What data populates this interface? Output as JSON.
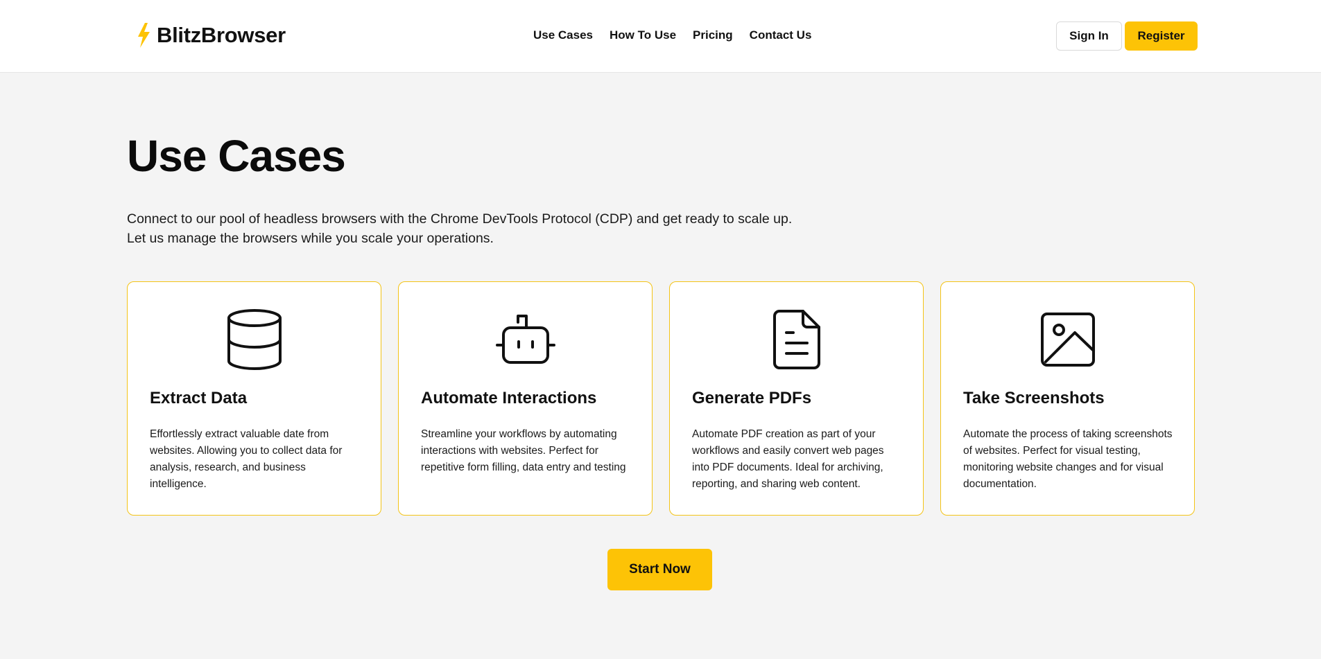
{
  "brand": {
    "name": "BlitzBrowser",
    "icon": "lightning-bolt-icon",
    "accent_color": "#fdc306"
  },
  "nav": {
    "items": [
      {
        "label": "Use Cases"
      },
      {
        "label": "How To Use"
      },
      {
        "label": "Pricing"
      },
      {
        "label": "Contact Us"
      }
    ]
  },
  "auth": {
    "signin_label": "Sign In",
    "register_label": "Register"
  },
  "main": {
    "title": "Use Cases",
    "intro_line1": "Connect to our pool of headless browsers with the Chrome DevTools Protocol (CDP) and get ready to scale up.",
    "intro_line2": "Let us manage the browsers while you scale your operations.",
    "cards": [
      {
        "icon": "database-icon",
        "title": "Extract Data",
        "description": "Effortlessly extract valuable date from websites. Allowing you to collect data for analysis, research, and business intelligence."
      },
      {
        "icon": "robot-icon",
        "title": "Automate Interactions",
        "description": "Streamline your workflows by automating interactions with websites. Perfect for repetitive form filling, data entry and testing"
      },
      {
        "icon": "document-icon",
        "title": "Generate PDFs",
        "description": "Automate PDF creation as part of your workflows and easily convert web pages into PDF documents. Ideal for archiving, reporting, and sharing web content."
      },
      {
        "icon": "image-icon",
        "title": "Take Screenshots",
        "description": "Automate the process of taking screenshots of websites. Perfect for visual testing, monitoring website changes and for visual documentation."
      }
    ],
    "cta_label": "Start Now"
  }
}
